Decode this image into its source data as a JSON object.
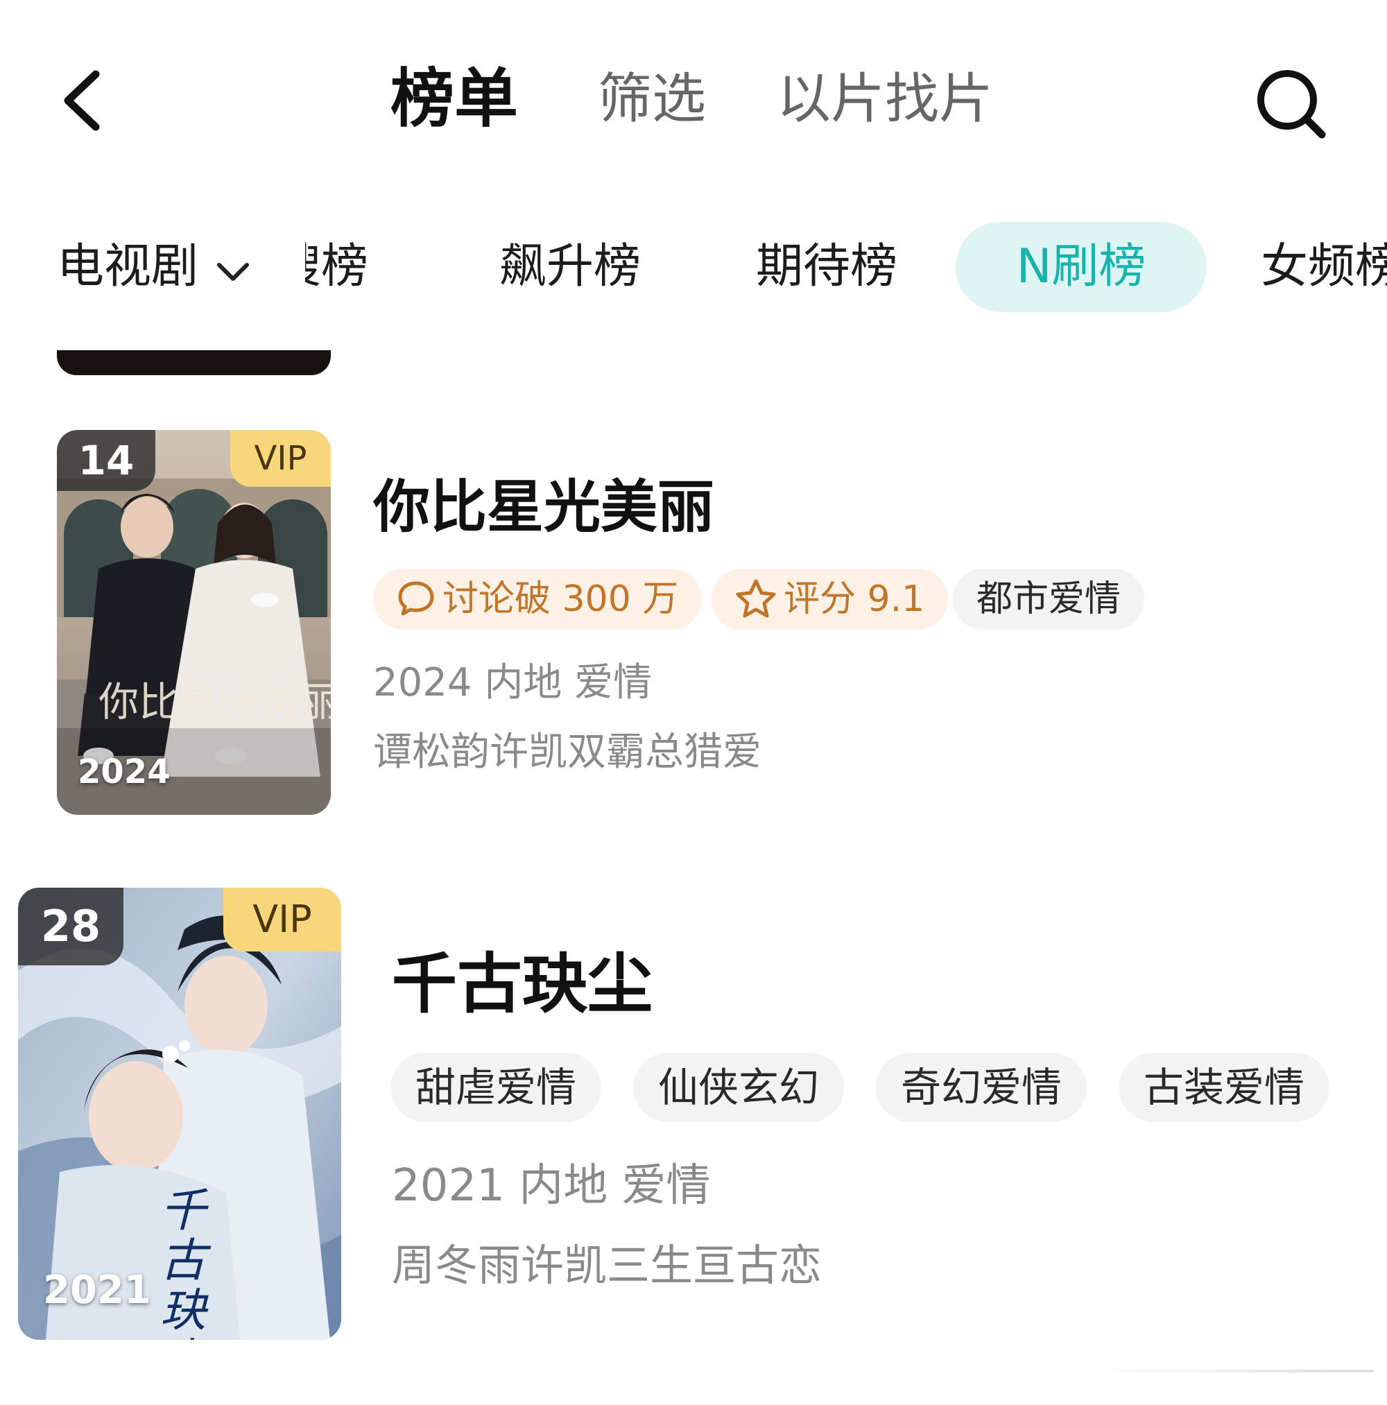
{
  "header": {
    "tabs": [
      {
        "label": "榜单",
        "active": true
      },
      {
        "label": "筛选",
        "active": false
      },
      {
        "label": "以片找片",
        "active": false
      }
    ]
  },
  "categories": {
    "selector": "电视剧",
    "items": [
      {
        "label": "搜榜",
        "active": false
      },
      {
        "label": "飙升榜",
        "active": false
      },
      {
        "label": "期待榜",
        "active": false
      },
      {
        "label": "N刷榜",
        "active": true
      },
      {
        "label": "女频榜",
        "active": false
      }
    ]
  },
  "shows": [
    {
      "rank": "14",
      "vip": "VIP",
      "poster_year": "2024",
      "poster_title": "你比星光美丽",
      "title": "你比星光美丽",
      "chips": [
        {
          "label": "讨论破 300 万",
          "style": "orange",
          "icon": "comment-icon"
        },
        {
          "label": "评分 9.1",
          "style": "orange",
          "icon": "star-icon"
        },
        {
          "label": "都市爱情",
          "style": "gray"
        }
      ],
      "meta": "2024 内地 爱情",
      "desc": "谭松韵许凯双霸总猎爱"
    },
    {
      "rank": "28",
      "vip": "VIP",
      "poster_year": "2021",
      "poster_title": "千古玦尘",
      "title": "千古玦尘",
      "chips": [
        {
          "label": "甜虐爱情",
          "style": "gray"
        },
        {
          "label": "仙侠玄幻",
          "style": "gray"
        },
        {
          "label": "奇幻爱情",
          "style": "gray"
        },
        {
          "label": "古装爱情",
          "style": "gray"
        }
      ],
      "meta": "2021 内地 爱情",
      "desc": "周冬雨许凯三生亘古恋"
    }
  ],
  "colors": {
    "accent": "#19b3ad",
    "accent_bg": "#dff5f4",
    "chip_orange_text": "#c07629",
    "chip_orange_bg": "#fdf0e4",
    "chip_gray_bg": "#f3f3f3",
    "vip_bg": "#f8d77c"
  }
}
